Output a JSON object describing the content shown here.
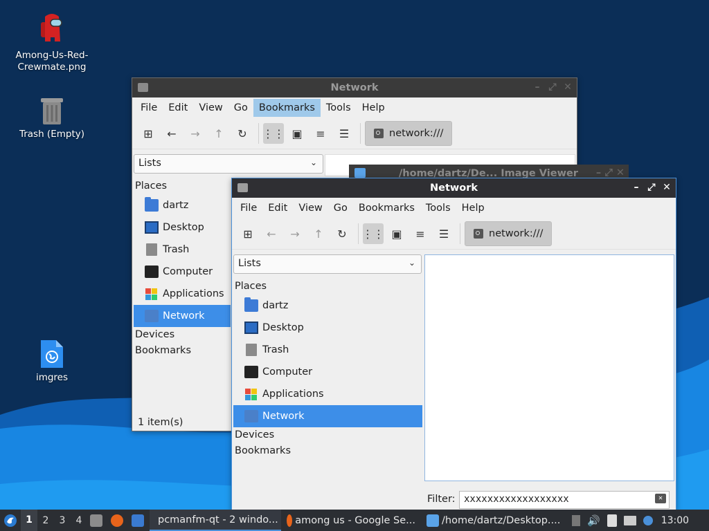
{
  "desktop": {
    "icons": [
      {
        "label_line1": "Among-Us-Red-",
        "label_line2": "Crewmate.png",
        "icon": "red-crewmate-icon"
      },
      {
        "label": "Trash (Empty)",
        "icon": "trash-icon"
      },
      {
        "label": "imgres",
        "icon": "web-file-icon"
      }
    ]
  },
  "back_window": {
    "title": "Network",
    "menu": [
      "File",
      "Edit",
      "View",
      "Go",
      "Bookmarks",
      "Tools",
      "Help"
    ],
    "highlighted_menu": "Bookmarks",
    "path": "network:///",
    "side_pane_mode": "Lists",
    "places_header": "Places",
    "places": [
      "dartz",
      "Desktop",
      "Trash",
      "Computer",
      "Applications",
      "Network"
    ],
    "selected_place": "Network",
    "devices_header": "Devices",
    "bookmarks_header": "Bookmarks",
    "status": "1 item(s)"
  },
  "image_viewer": {
    "title": "/home/dartz/De... Image Viewer"
  },
  "front_window": {
    "title": "Network",
    "menu": [
      "File",
      "Edit",
      "View",
      "Go",
      "Bookmarks",
      "Tools",
      "Help"
    ],
    "path": "network:///",
    "side_pane_mode": "Lists",
    "places_header": "Places",
    "places": [
      "dartz",
      "Desktop",
      "Trash",
      "Computer",
      "Applications",
      "Network"
    ],
    "selected_place": "Network",
    "devices_header": "Devices",
    "bookmarks_header": "Bookmarks",
    "filter_label": "Filter:",
    "filter_value": "xxxxxxxxxxxxxxxxxx"
  },
  "taskbar": {
    "workspaces": [
      "1",
      "2",
      "3",
      "4"
    ],
    "current_workspace": "1",
    "tasks": [
      {
        "label": "pcmanfm-qt - 2 windo...",
        "active": true
      },
      {
        "label": "among us - Google Se...",
        "active": false
      },
      {
        "label": "/home/dartz/Desktop....",
        "active": false
      }
    ],
    "clock": "13:00"
  },
  "colors": {
    "selection": "#3d8ee8",
    "menu_highlight": "#9fc9ea",
    "titlebar_active": "#2f2f33",
    "taskbar": "#2b2e33"
  }
}
